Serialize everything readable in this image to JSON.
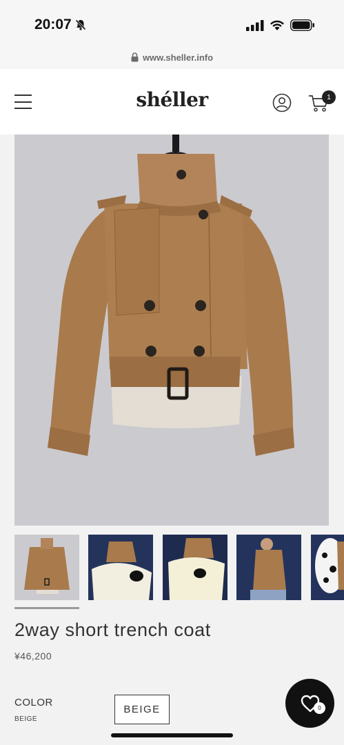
{
  "status_bar": {
    "time": "20:07",
    "icons": [
      "bell-slash-icon",
      "signal-icon",
      "wifi-icon",
      "battery-icon"
    ]
  },
  "browser": {
    "url": "www.sheller.info",
    "lock_icon": "lock-icon"
  },
  "header": {
    "logo": "shéller",
    "menu_icon": "hamburger-menu-icon",
    "account_icon": "user-circle-icon",
    "cart_icon": "cart-icon",
    "cart_count": "1"
  },
  "product": {
    "title": "2way short trench coat",
    "price": "¥46,200",
    "thumbnail_count": 5,
    "selected_thumbnail": 1,
    "color_label": "COLOR",
    "selected_color": "BEIGE",
    "color_options": [
      "BEIGE"
    ]
  },
  "wishlist": {
    "icon": "heart-icon",
    "count": "0"
  },
  "colors": {
    "image_background": "#cbcacf",
    "coat": "#a87a4c",
    "accent": "#111111"
  }
}
